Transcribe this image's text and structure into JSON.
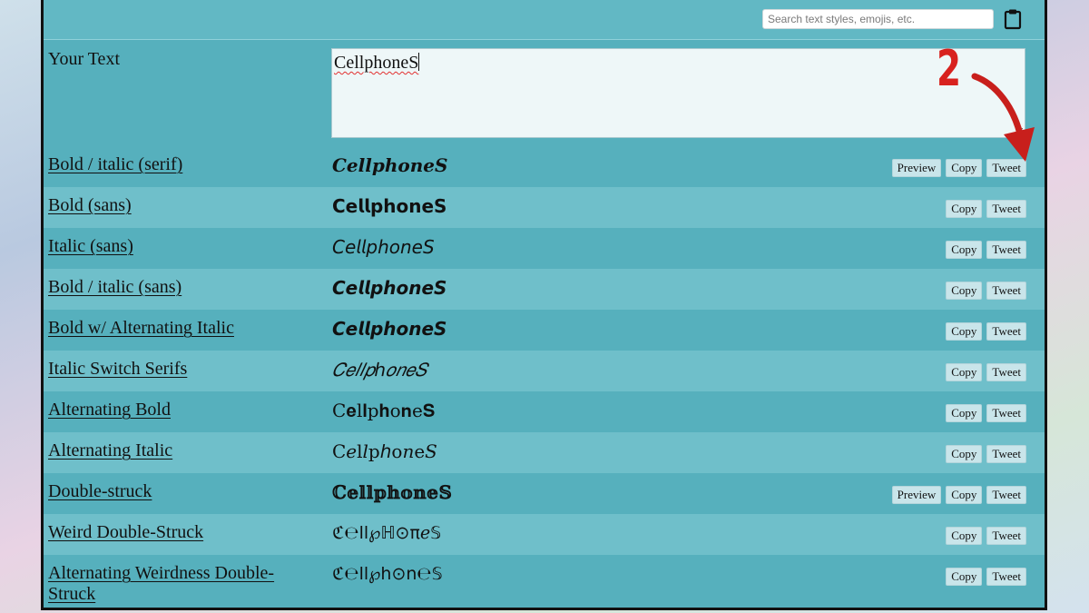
{
  "search": {
    "placeholder": "Search text styles, emojis, etc."
  },
  "input": {
    "label": "Your Text",
    "value": "CellphoneS"
  },
  "annotation": {
    "step": "2"
  },
  "buttons": {
    "preview": "Preview",
    "copy": "Copy",
    "tweet": "Tweet"
  },
  "colors": {
    "panel": "#5ab1be",
    "row_alt": "#6fbfca",
    "annotation": "#d8221f"
  },
  "icons": {
    "clipboard": "clipboard-icon",
    "arrow": "red-arrow"
  },
  "styles": [
    {
      "name": "Bold / italic (serif)",
      "sample": "𝑪𝒆𝒍𝒍𝒑𝒉𝒐𝒏𝒆𝑺",
      "preview": true
    },
    {
      "name": "Bold (sans)",
      "sample": "𝗖𝗲𝗹𝗹𝗽𝗵𝗼𝗻𝗲𝗦",
      "preview": false
    },
    {
      "name": "Italic (sans)",
      "sample": "𝘊𝘦𝘭𝘭𝘱𝘩𝘰𝘯𝘦𝘚",
      "preview": false
    },
    {
      "name": "Bold / italic (sans)",
      "sample": "𝘾𝙚𝙡𝙡𝙥𝙝𝙤𝙣𝙚𝙎",
      "preview": false
    },
    {
      "name": "Bold w/ Alternating Italic",
      "sample": "𝘾𝙚𝙡𝙡𝙥𝙝𝙤𝙣𝙚𝙎",
      "preview": false
    },
    {
      "name": "Italic Switch Serifs",
      "sample": "𝐶𝑒𝑙𝑙𝑝ℎ𝑜𝑛𝑒𝑆",
      "preview": false
    },
    {
      "name": "Alternating Bold",
      "sample": "C𝐞l𝐥p𝐡o𝐧e𝐒",
      "preview": false
    },
    {
      "name": "Alternating Italic",
      "sample": "C𝑒l𝑙p𝘩o𝑛e𝑆",
      "preview": false
    },
    {
      "name": "Double-struck",
      "sample": "ℂ𝕖𝕝𝕝𝕡𝕙𝕠𝕟𝕖𝕊",
      "preview": true
    },
    {
      "name": "Weird Double-Struck",
      "sample": "ℭ℮ll℘ℍ⊙πℯ𝕊",
      "preview": false
    },
    {
      "name": "Alternating Weirdness Double-Struck",
      "sample": "ℭ℮ll℘h⊙n℮𝕊",
      "preview": false
    }
  ]
}
